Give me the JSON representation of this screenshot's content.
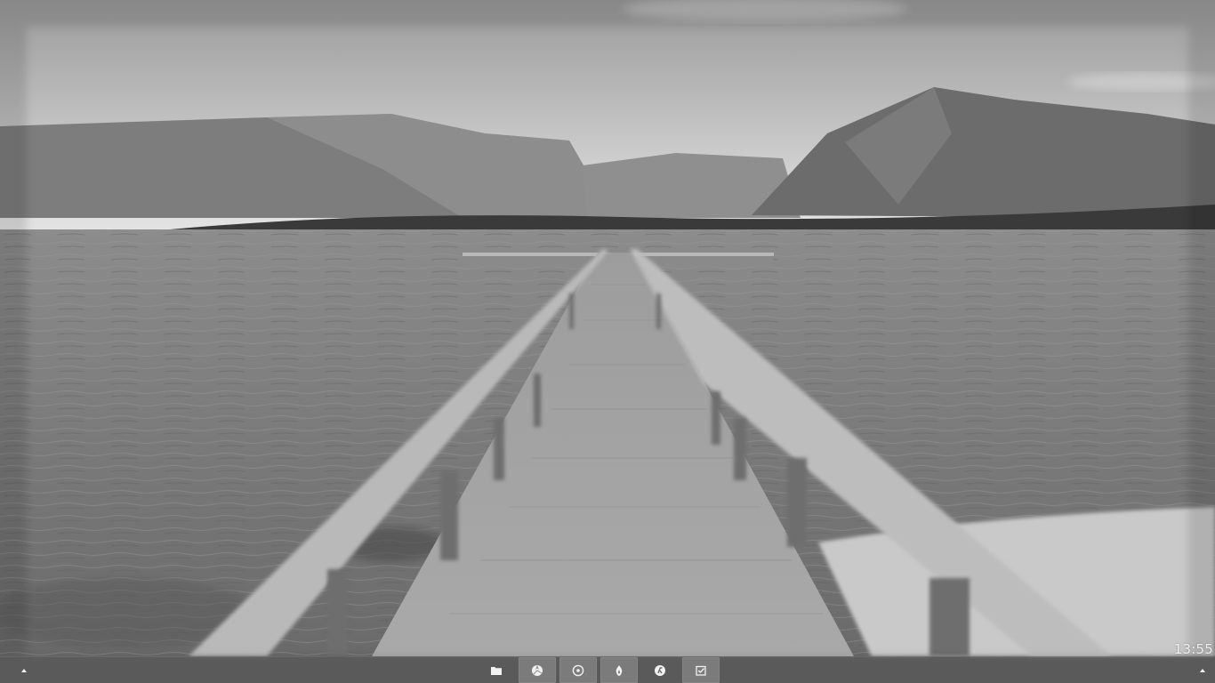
{
  "desktop": {
    "wallpaper": "grayscale-lake-pier-mountains"
  },
  "clock": {
    "time": "13:55"
  },
  "taskbar": {
    "left_toggle_icon": "arrow-up-icon",
    "right_toggle_icon": "arrow-up-icon",
    "launcher_items": [
      {
        "icon": "folder-icon",
        "active": false
      },
      {
        "icon": "browser-icon",
        "active": true
      },
      {
        "icon": "media-player-icon",
        "active": true
      },
      {
        "icon": "flame-icon",
        "active": true
      },
      {
        "icon": "script-icon",
        "active": false
      },
      {
        "icon": "task-check-icon",
        "active": true
      }
    ],
    "colors": {
      "bar": "#3c3c3c",
      "icon": "#f2f2f2",
      "active_bg": "#d2d2d2"
    }
  }
}
